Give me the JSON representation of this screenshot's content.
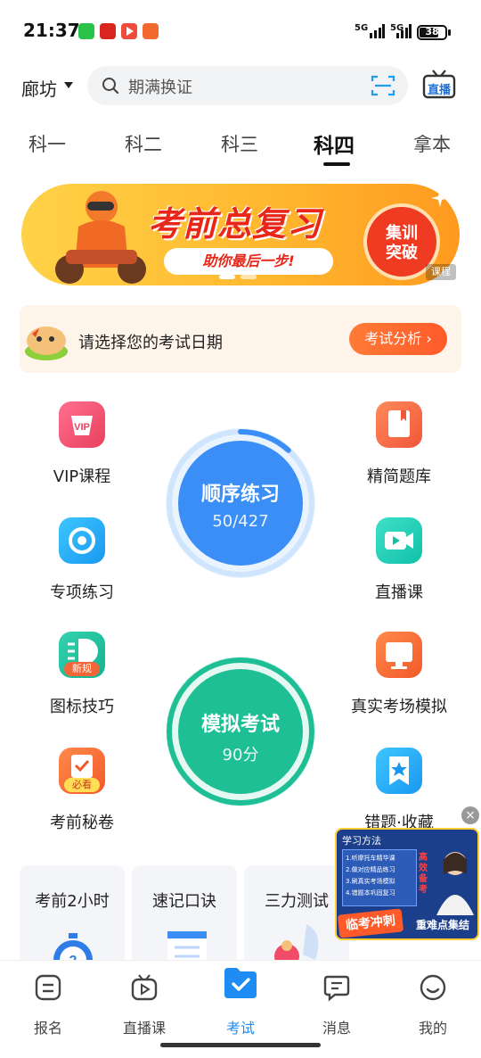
{
  "status_bar": {
    "time": "21:37",
    "signal_1": "5G",
    "signal_2": "5G",
    "battery": "38"
  },
  "header": {
    "city": "廊坊",
    "search_placeholder": "期满换证",
    "live_label": "直播"
  },
  "tabs": [
    {
      "label": "科一",
      "active": false
    },
    {
      "label": "科二",
      "active": false
    },
    {
      "label": "科三",
      "active": false
    },
    {
      "label": "科四",
      "active": true
    },
    {
      "label": "拿本",
      "active": false
    }
  ],
  "banner": {
    "title": "考前总复习",
    "subtitle": "助你最后一步!",
    "badge_line1": "集训",
    "badge_line2": "突破",
    "tag": "课程"
  },
  "exam_date": {
    "prompt": "请选择您的考试日期",
    "button": "考试分析 ›"
  },
  "grid": {
    "left": [
      {
        "label": "VIP课程",
        "icon": "vip-icon"
      },
      {
        "label": "专项练习",
        "icon": "target-icon"
      },
      {
        "label": "图标技巧",
        "icon": "sign-icon",
        "icon_tag": "新规"
      },
      {
        "label": "考前秘卷",
        "icon": "exam-paper-icon",
        "icon_tag": "必看"
      }
    ],
    "right": [
      {
        "label": "精简题库",
        "icon": "book-icon"
      },
      {
        "label": "直播课",
        "icon": "video-icon"
      },
      {
        "label": "真实考场模拟",
        "icon": "monitor-icon"
      },
      {
        "label": "错题·收藏",
        "icon": "star-bookmark-icon"
      }
    ]
  },
  "practice": {
    "label": "顺序练习",
    "progress_text": "50/427",
    "done": 50,
    "total": 427
  },
  "mock_exam": {
    "label": "模拟考试",
    "score": "90分"
  },
  "mini_cards": [
    {
      "label": "考前2小时"
    },
    {
      "label": "速记口诀"
    },
    {
      "label": "三力测试"
    }
  ],
  "promo": {
    "header": "学习方法",
    "lines": [
      "1.听摩托车精华课",
      "2.做对应精品练习",
      "3.刷真实考场模拟",
      "4.错题本巩固复习"
    ],
    "side_text": "高效备考",
    "stamp": "临考冲刺",
    "caption": "重难点集结"
  },
  "tab_bar": [
    {
      "label": "报名",
      "icon": "signup-icon",
      "active": false
    },
    {
      "label": "直播课",
      "icon": "tv-icon",
      "active": false
    },
    {
      "label": "考试",
      "icon": "exam-folder-icon",
      "active": true
    },
    {
      "label": "消息",
      "icon": "message-icon",
      "active": false
    },
    {
      "label": "我的",
      "icon": "profile-icon",
      "active": false
    }
  ],
  "colors": {
    "accent_blue": "#1e8cf2",
    "practice_blue": "#3a8ef6",
    "mock_green": "#1fbf95",
    "orange": "#ff6a2c"
  }
}
